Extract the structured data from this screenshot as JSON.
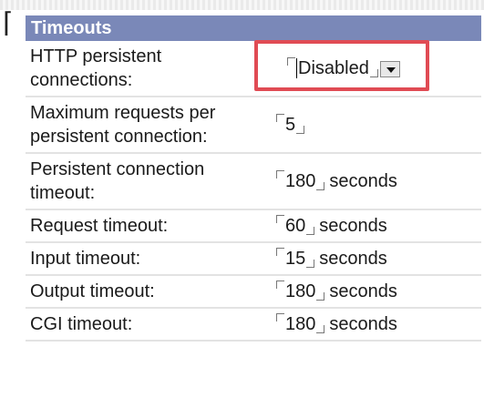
{
  "section": {
    "title": "Timeouts"
  },
  "rows": [
    {
      "label_lines": [
        "HTTP persistent",
        "connections:"
      ],
      "value": "Disabled",
      "unit": "",
      "control": "dropdown"
    },
    {
      "label_lines": [
        "Maximum requests per",
        "persistent connection:"
      ],
      "value": "5",
      "unit": ""
    },
    {
      "label_lines": [
        "Persistent connection",
        "timeout:"
      ],
      "value": "180",
      "unit": "seconds"
    },
    {
      "label_lines": [
        "Request timeout:"
      ],
      "value": "60",
      "unit": "seconds"
    },
    {
      "label_lines": [
        "Input timeout:"
      ],
      "value": "15",
      "unit": "seconds"
    },
    {
      "label_lines": [
        "Output timeout:"
      ],
      "value": "180",
      "unit": "seconds"
    },
    {
      "label_lines": [
        "CGI timeout:"
      ],
      "value": "180",
      "unit": "seconds"
    }
  ],
  "colors": {
    "header_bg": "#7a88b8",
    "highlight_border": "#e04b54",
    "row_divider": "#e3e3e3"
  },
  "icons": {
    "dropdown": "chevron-down-icon",
    "field_marker_open": "bracket-open-icon",
    "field_marker_close": "bracket-close-icon"
  }
}
